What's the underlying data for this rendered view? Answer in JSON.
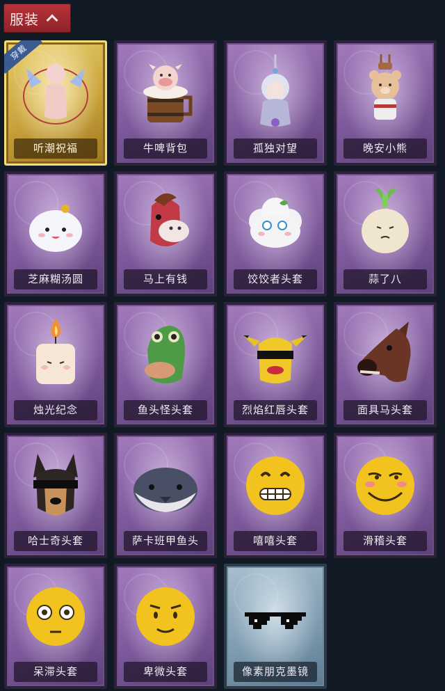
{
  "header": {
    "title": "服装"
  },
  "badge": {
    "equipped": "穿戴"
  },
  "items": [
    {
      "label": "听潮祝福",
      "icon": "angel-wings-mannequin-icon"
    },
    {
      "label": "牛啤背包",
      "icon": "cow-beer-mug-icon"
    },
    {
      "label": "孤独对望",
      "icon": "doll-charm-icon"
    },
    {
      "label": "晚安小熊",
      "icon": "teddy-bear-charm-icon"
    },
    {
      "label": "芝麻糊汤圆",
      "icon": "dumpling-icon"
    },
    {
      "label": "马上有钱",
      "icon": "red-horse-mask-icon"
    },
    {
      "label": "饺饺者头套",
      "icon": "cloud-head-icon"
    },
    {
      "label": "蒜了八",
      "icon": "garlic-icon"
    },
    {
      "label": "烛光纪念",
      "icon": "candle-icon"
    },
    {
      "label": "鱼头怪头套",
      "icon": "fish-mask-icon"
    },
    {
      "label": "烈焰红唇头套",
      "icon": "yellow-mouse-mask-icon"
    },
    {
      "label": "面具马头套",
      "icon": "horse-mask-icon"
    },
    {
      "label": "哈士奇头套",
      "icon": "husky-mask-icon"
    },
    {
      "label": "萨卡班甲鱼头",
      "icon": "round-fish-icon"
    },
    {
      "label": "嘻嘻头套",
      "icon": "grin-emoji-icon"
    },
    {
      "label": "滑稽头套",
      "icon": "smirk-emoji-icon"
    },
    {
      "label": "呆滞头套",
      "icon": "stare-emoji-icon"
    },
    {
      "label": "卑微头套",
      "icon": "humble-emoji-icon"
    },
    {
      "label": "像素朋克墨镜",
      "icon": "pixel-sunglasses-icon"
    }
  ]
}
